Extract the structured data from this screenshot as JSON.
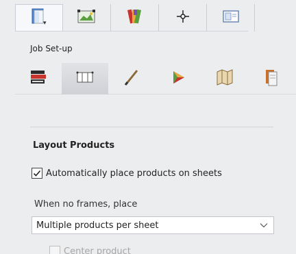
{
  "top_tabs": [
    {
      "icon": "job-setup-icon",
      "active": true
    },
    {
      "icon": "layout-preview-icon"
    },
    {
      "icon": "color-swatch-icon"
    },
    {
      "icon": "target-crosshair-icon"
    },
    {
      "icon": "window-panel-icon"
    }
  ],
  "section_label": "Job Set-up",
  "tool_row": [
    {
      "icon": "book-stack-icon"
    },
    {
      "icon": "layout-grid-icon",
      "active": true
    },
    {
      "icon": "pen-icon"
    },
    {
      "icon": "color-triangle-icon"
    },
    {
      "icon": "folded-map-icon"
    },
    {
      "icon": "document-pages-icon"
    }
  ],
  "layout_products": {
    "heading": "Layout Products",
    "auto_place_label": "Automatically place products on sheets",
    "auto_place_checked": true,
    "no_frames_label": "When no frames, place",
    "placement_select": "Multiple products per sheet",
    "center_product_label": "Center product",
    "center_product_checked": false
  },
  "colors": {
    "accent_blue": "#2c6fd6",
    "icon_red": "#c8332c"
  }
}
